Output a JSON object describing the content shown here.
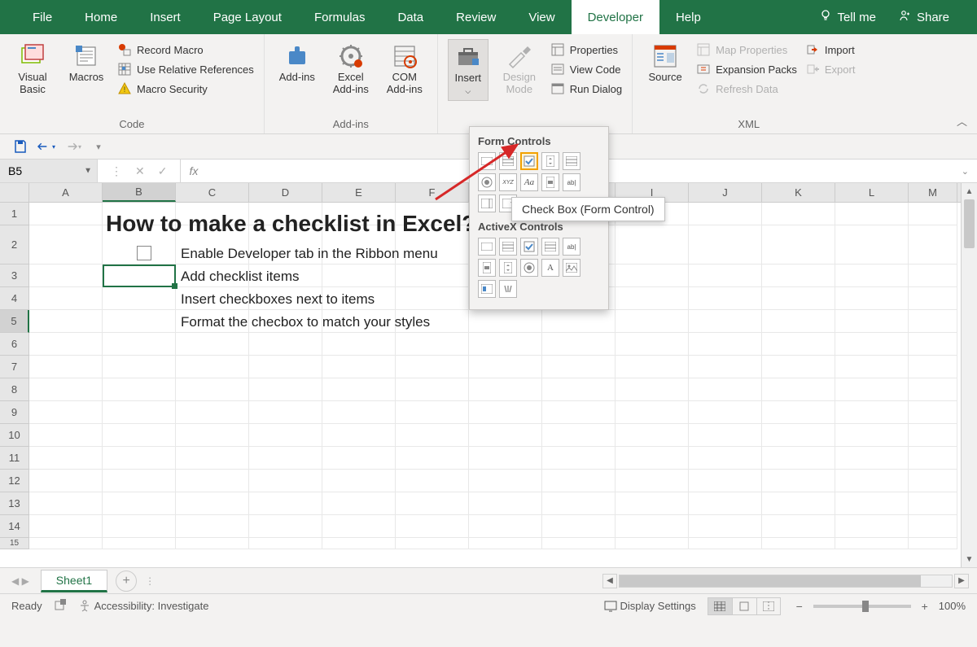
{
  "ribbon_tabs": {
    "file": "File",
    "home": "Home",
    "insert": "Insert",
    "page_layout": "Page Layout",
    "formulas": "Formulas",
    "data": "Data",
    "review": "Review",
    "view": "View",
    "developer": "Developer",
    "help": "Help",
    "tell_me": "Tell me",
    "share": "Share"
  },
  "ribbon": {
    "code": {
      "visual_basic": "Visual Basic",
      "macros": "Macros",
      "record_macro": "Record Macro",
      "use_relative": "Use Relative References",
      "macro_security": "Macro Security",
      "label": "Code"
    },
    "addins": {
      "addins": "Add-ins",
      "excel_addins": "Excel Add-ins",
      "com_addins": "COM Add-ins",
      "label": "Add-ins"
    },
    "controls": {
      "insert": "Insert",
      "design_mode": "Design Mode",
      "properties": "Properties",
      "view_code": "View Code",
      "run_dialog": "Run Dialog"
    },
    "xml": {
      "source": "Source",
      "map_props": "Map Properties",
      "expansion": "Expansion Packs",
      "refresh": "Refresh Data",
      "import": "Import",
      "export": "Export",
      "label": "XML"
    }
  },
  "dropdown": {
    "form_controls": "Form Controls",
    "activex_controls": "ActiveX Controls",
    "tooltip": "Check Box (Form Control)"
  },
  "namebox": "B5",
  "sheet": {
    "columns": [
      "A",
      "B",
      "C",
      "D",
      "E",
      "F",
      "G",
      "H",
      "I",
      "J",
      "K",
      "L",
      "M"
    ],
    "rows": [
      "1",
      "2",
      "3",
      "4",
      "5",
      "6",
      "7",
      "8",
      "9",
      "10",
      "11",
      "12",
      "13",
      "14",
      "15"
    ],
    "title": "How to make a checklist in Excel?",
    "items": {
      "r4": "Enable Developer tab in the Ribbon menu",
      "r5": "Add checklist items",
      "r6": "Insert checkboxes next to items",
      "r7": "Format the checbox to match your styles"
    },
    "tab_name": "Sheet1"
  },
  "status": {
    "ready": "Ready",
    "accessibility": "Accessibility: Investigate",
    "display_settings": "Display Settings",
    "zoom": "100%"
  }
}
